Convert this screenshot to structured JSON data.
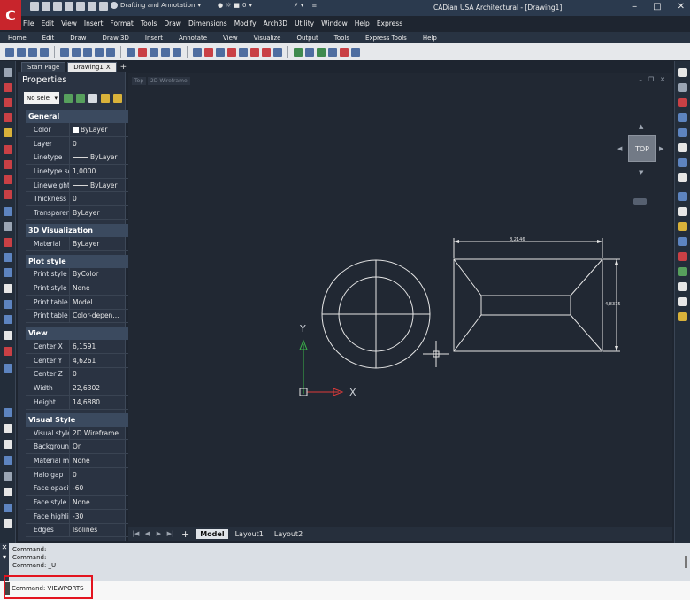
{
  "app": {
    "logo_letter": "C",
    "window_title": "CADian USA Architectural - [Drawing1]",
    "workspace": "Drafting and Annotation",
    "layer_value": "0"
  },
  "menu": [
    "File",
    "Edit",
    "View",
    "Insert",
    "Format",
    "Tools",
    "Draw",
    "Dimensions",
    "Modify",
    "Arch3D",
    "Utility",
    "Window",
    "Help",
    "Express"
  ],
  "ribbon_tabs": [
    "Home",
    "Edit",
    "Draw",
    "Draw 3D",
    "Insert",
    "Annotate",
    "View",
    "Visualize",
    "Output",
    "Tools",
    "Express Tools",
    "Help"
  ],
  "doc_tabs": {
    "start": "Start Page",
    "drawing": "Drawing1",
    "close": "X",
    "add": "+"
  },
  "properties": {
    "title": "Properties",
    "selection": "No sele",
    "sections": [
      {
        "name": "General",
        "rows": [
          {
            "k": "Color",
            "v": "ByLayer"
          },
          {
            "k": "Layer",
            "v": "0"
          },
          {
            "k": "Linetype",
            "v": "ByLayer"
          },
          {
            "k": "Linetype scale",
            "v": "1,0000"
          },
          {
            "k": "Lineweight",
            "v": "ByLayer"
          },
          {
            "k": "Thickness",
            "v": "0"
          },
          {
            "k": "Transparency",
            "v": "ByLayer"
          }
        ]
      },
      {
        "name": "3D Visualization",
        "rows": [
          {
            "k": "Material",
            "v": "ByLayer"
          }
        ]
      },
      {
        "name": "Plot style",
        "rows": [
          {
            "k": "Print style",
            "v": "ByColor"
          },
          {
            "k": "Print style ta...",
            "v": "None"
          },
          {
            "k": "Print table at...",
            "v": "Model"
          },
          {
            "k": "Print table type",
            "v": "Color-depen..."
          }
        ]
      },
      {
        "name": "View",
        "rows": [
          {
            "k": "Center X",
            "v": "6,1591"
          },
          {
            "k": "Center Y",
            "v": "4,6261"
          },
          {
            "k": "Center Z",
            "v": "0"
          },
          {
            "k": "Width",
            "v": "22,6302"
          },
          {
            "k": "Height",
            "v": "14,6880"
          }
        ]
      },
      {
        "name": "Visual Style",
        "rows": [
          {
            "k": "Visual style",
            "v": "2D Wireframe"
          },
          {
            "k": "Background",
            "v": "On"
          },
          {
            "k": "Material mode",
            "v": "None"
          },
          {
            "k": "Halo gap",
            "v": "0"
          },
          {
            "k": "Face opacity",
            "v": "-60"
          },
          {
            "k": "Face style",
            "v": "None"
          },
          {
            "k": "Face highlight",
            "v": "-30"
          },
          {
            "k": "Edges",
            "v": "Isolines"
          }
        ]
      }
    ]
  },
  "viewport": {
    "view_label": "Top",
    "style_label": "2D Wireframe",
    "viewcube_face": "TOP",
    "dim_horizontal": "8,2146",
    "dim_vertical": "4,8315",
    "ucs_x": "X",
    "ucs_y": "Y"
  },
  "model_tabs": {
    "add": "+",
    "tabs": [
      "Model",
      "Layout1",
      "Layout2"
    ]
  },
  "command": {
    "history": [
      "Command:",
      "Command:",
      "Command: _U"
    ],
    "input": "Command: VIEWPORTS"
  },
  "colors": {
    "canvas": "#212833",
    "highlight": "#e3141f",
    "ucs_y": "#3bb54a",
    "ucs_x": "#e03a3a"
  }
}
